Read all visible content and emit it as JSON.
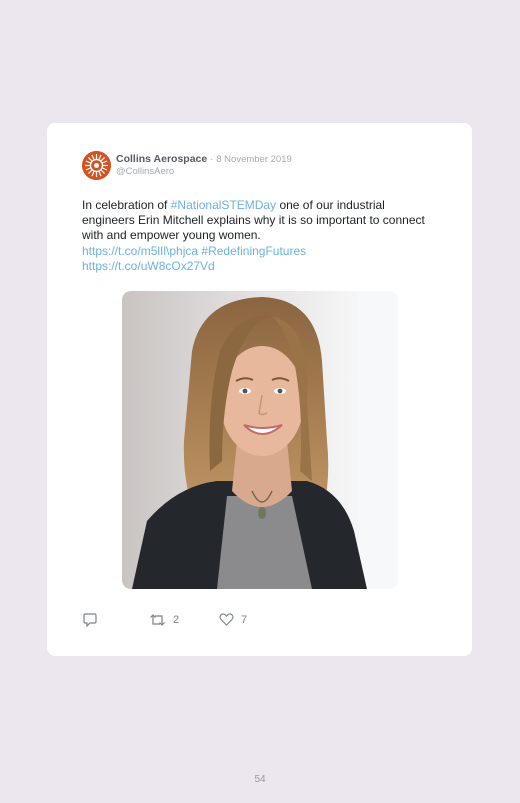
{
  "tweet": {
    "author_name": "Collins Aerospace",
    "separator": "·",
    "date": "8 November 2019",
    "handle": "@CollinsAero",
    "text_1": "In celebration of ",
    "hashtag_1": "#NationalSTEMDay",
    "text_2": " one of our industrial engineers Erin Mitchell explains why it is so important to connect with and empower young women.",
    "link_1": "https://t.co/m5lIl\\phjca",
    "hashtag_2": "#RedefiningFutures",
    "link_2": "https://t.co/uW8cOx27Vd",
    "image_icon": "photo-of-smiling-woman"
  },
  "actions": {
    "reply_icon": "reply-icon",
    "retweet_icon": "retweet-icon",
    "retweet_count": "2",
    "like_icon": "heart-icon",
    "like_count": "7"
  },
  "page": {
    "number": "54"
  },
  "colors": {
    "background": "#ece6ee",
    "link": "#6ab2e3",
    "brand": "#d4521f"
  }
}
